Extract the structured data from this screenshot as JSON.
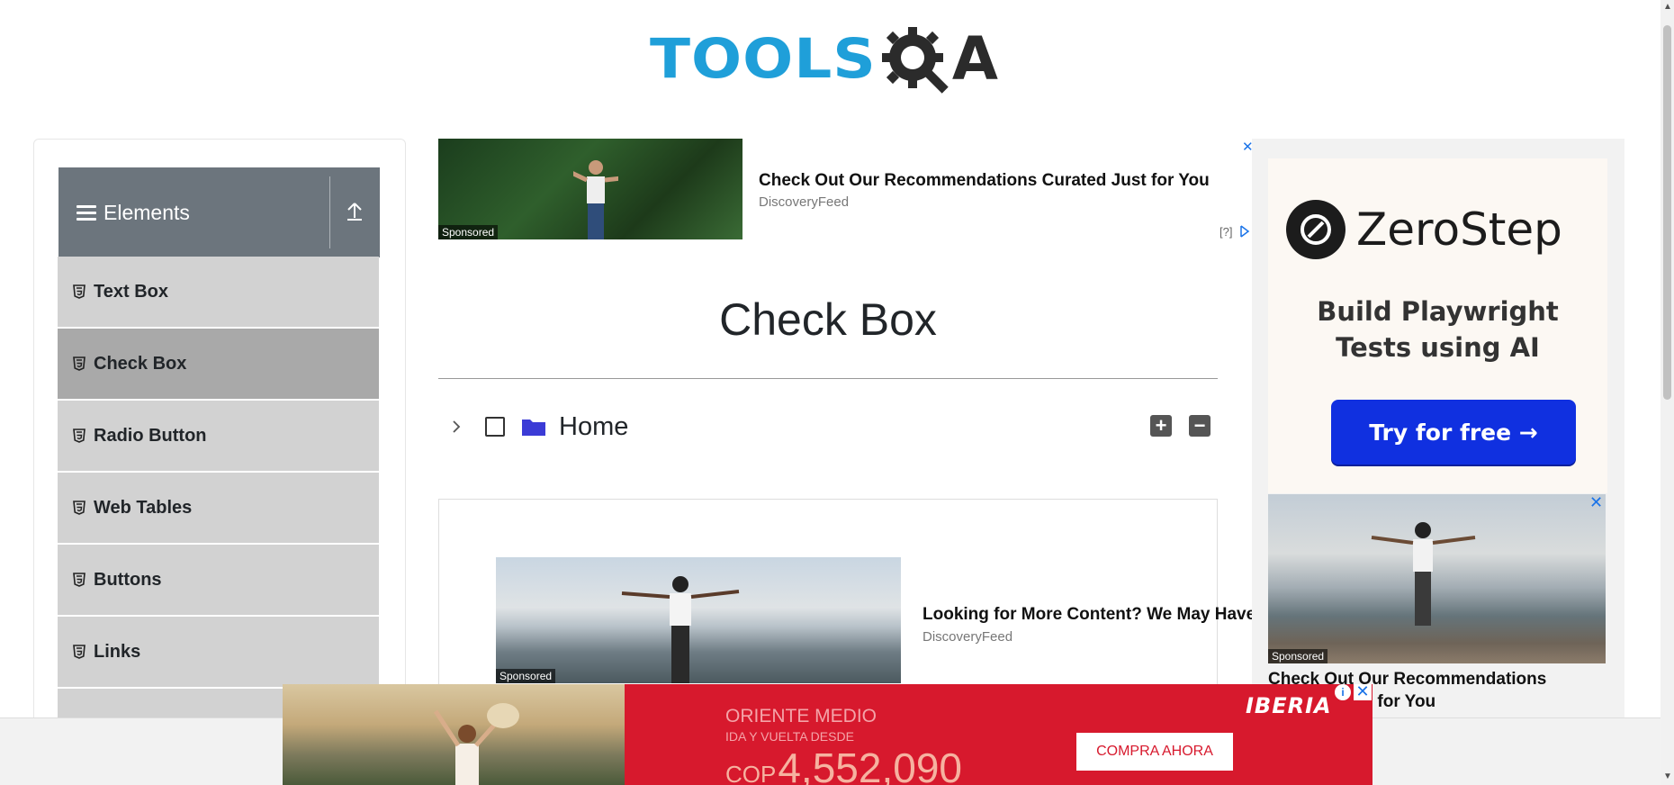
{
  "logo": {
    "part1": "TOOLS",
    "part2": "A"
  },
  "sidebar": {
    "group_title": "Elements",
    "items": [
      {
        "label": "Text Box",
        "active": false
      },
      {
        "label": "Check Box",
        "active": true
      },
      {
        "label": "Radio Button",
        "active": false
      },
      {
        "label": "Web Tables",
        "active": false
      },
      {
        "label": "Buttons",
        "active": false
      },
      {
        "label": "Links",
        "active": false
      }
    ]
  },
  "top_ad": {
    "sponsored": "Sponsored",
    "headline": "Check Out Our Recommendations Curated Just for You",
    "source": "DiscoveryFeed",
    "help": "[?]",
    "close": "✕"
  },
  "page": {
    "title": "Check Box"
  },
  "tree": {
    "root_label": "Home",
    "expand_all": "+",
    "collapse_all": "−"
  },
  "mid_ad": {
    "sponsored": "Sponsored",
    "headline": "Looking for More Content? We May Have",
    "source": "DiscoveryFeed"
  },
  "right_ad": {
    "brand": "ZeroStep",
    "tagline_line1": "Build Playwright",
    "tagline_line2": "Tests using AI",
    "cta": "Try for free →",
    "ad2_sponsored": "Sponsored",
    "ad2_headline": "Check Out Our Recommendations Curated Just for You",
    "ad2_close": "✕"
  },
  "bottom_banner": {
    "destination": "ORIENTE MEDIO",
    "subtitle": "IDA Y VUELTA DESDE",
    "currency": "COP",
    "price": "4,552,090",
    "cta": "COMPRA AHORA",
    "brand": "IBERIA",
    "info": "i",
    "close": "✕"
  },
  "colors": {
    "sidebar_header": "#6c757d",
    "menu_item": "#d2d2d2",
    "menu_active": "#a9a9a9",
    "logo_blue": "#1f9fd9",
    "folder": "#3b3bd6",
    "iberia_red": "#d7192d",
    "zerostep_blue": "#1030e0"
  }
}
